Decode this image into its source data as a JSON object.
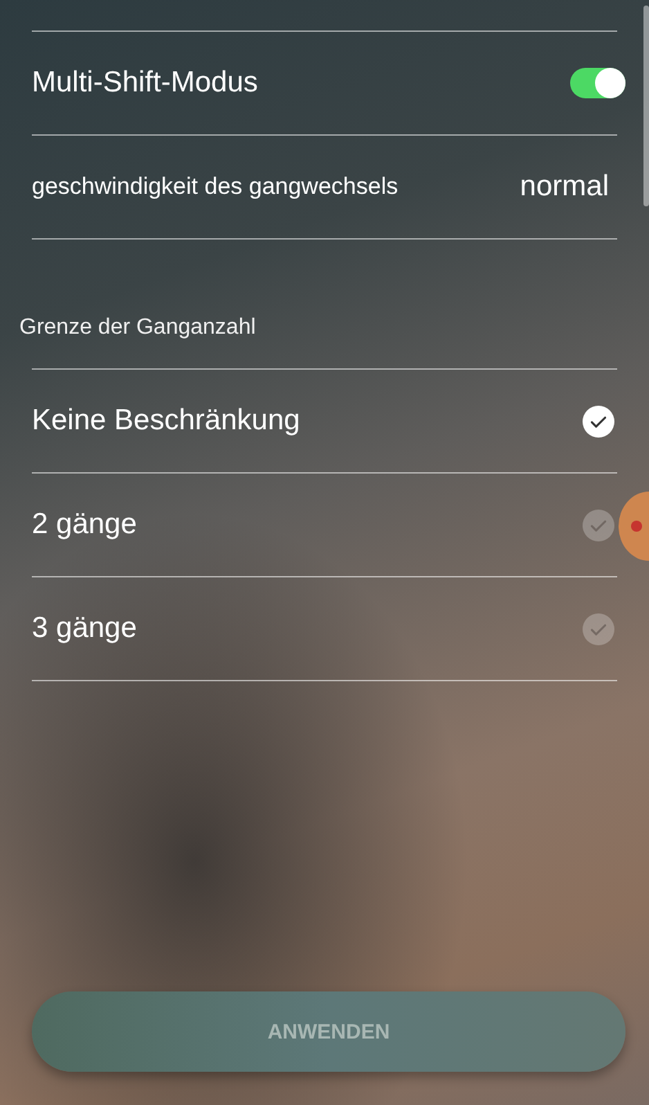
{
  "settings": [
    {
      "kind": "toggle",
      "label": "Multi-Shift-Modus",
      "on": true
    },
    {
      "kind": "value",
      "label": "geschwindigkeit des gangwechsels",
      "value": "normal"
    }
  ],
  "gear_limit": {
    "title": "Grenze der Ganganzahl",
    "options": [
      {
        "label": "Keine Beschränkung",
        "selected": true
      },
      {
        "label": "2 gänge",
        "selected": false
      },
      {
        "label": "3 gänge",
        "selected": false
      }
    ]
  },
  "apply_button": {
    "label": "ANWENDEN",
    "disabled": true
  }
}
